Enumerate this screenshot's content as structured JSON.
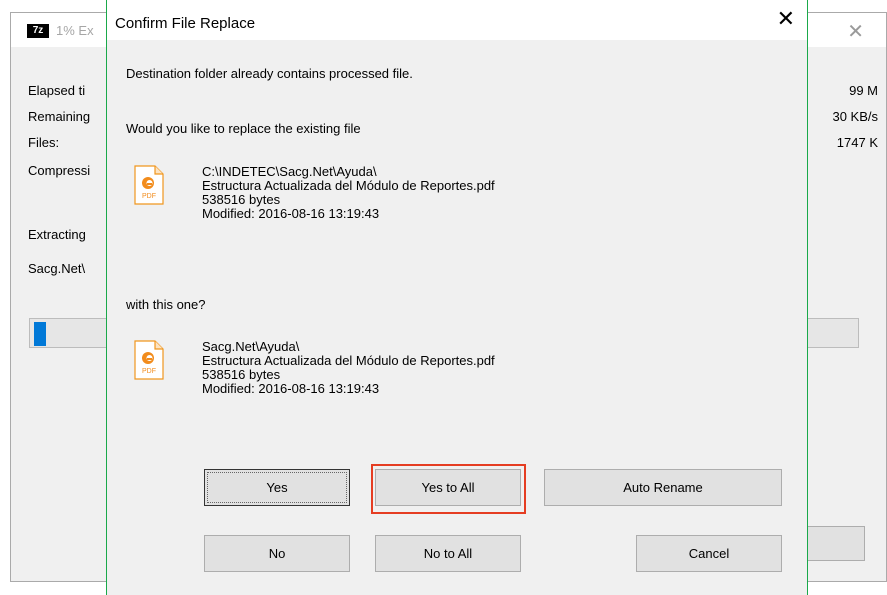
{
  "background_window": {
    "icon_text": "7z",
    "title": "1% Ex",
    "labels": [
      "Elapsed ti",
      "Remaining",
      "Files:",
      "Compressi",
      "Extracting",
      "Sacg.Net\\"
    ],
    "values": [
      "99 M",
      "30 KB/s",
      "1747 K"
    ],
    "progress_percent": 1
  },
  "dialog": {
    "title": "Confirm File Replace",
    "message": "Destination folder already contains processed file.",
    "question": "Would you like to replace the existing file",
    "existing_file": {
      "path": "C:\\INDETEC\\Sacg.Net\\Ayuda\\",
      "name": "Estructura Actualizada del Módulo de Reportes.pdf",
      "size": "538516 bytes",
      "modified": "Modified: 2016-08-16 13:19:43"
    },
    "with_this": "with this one?",
    "new_file": {
      "path": "Sacg.Net\\Ayuda\\",
      "name": "Estructura Actualizada del Módulo de Reportes.pdf",
      "size": "538516 bytes",
      "modified": "Modified: 2016-08-16 13:19:43"
    },
    "icon_label": "PDF",
    "buttons": {
      "yes": "Yes",
      "yes_to_all": "Yes to All",
      "auto_rename": "Auto Rename",
      "no": "No",
      "no_to_all": "No to All",
      "cancel": "Cancel"
    },
    "close_glyph": "✕"
  },
  "colors": {
    "accent_border": "#1aa94a",
    "highlight": "#e53d22",
    "progress": "#0078d7"
  }
}
